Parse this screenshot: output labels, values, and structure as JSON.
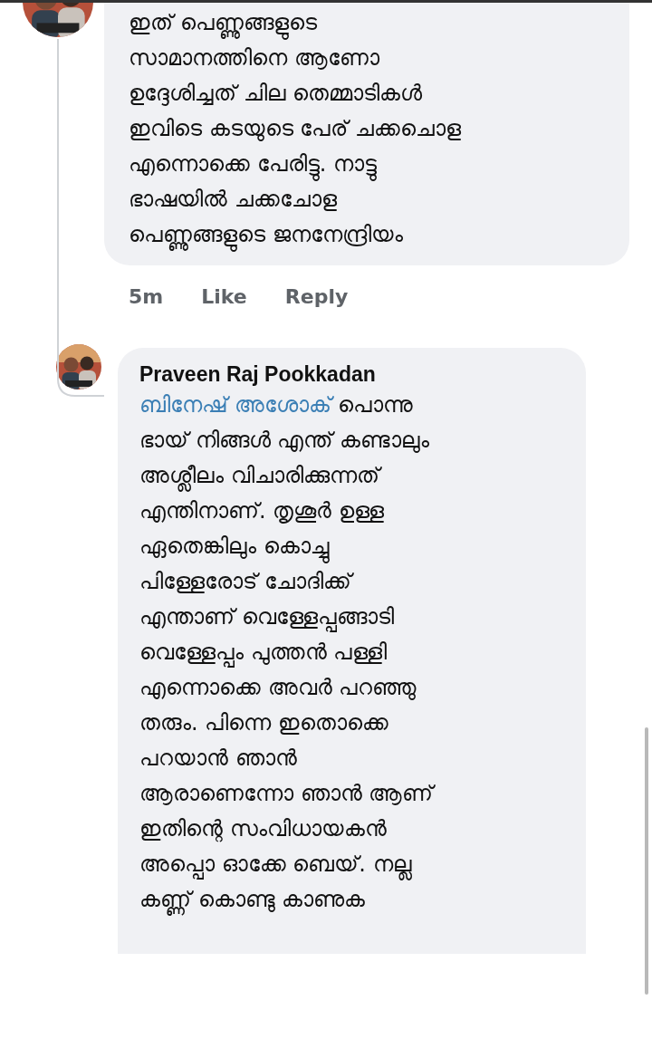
{
  "comments": [
    {
      "lines": [
        "ഇത് പെണ്ണുങ്ങളുടെ",
        "സാമാനത്തിനെ ആണോ",
        "ഉദ്ദേശിച്ചത് ചില തെമ്മാടികൾ",
        "ഇവിടെ കടയുടെ പേര് ചക്കചൊള",
        "എന്നൊക്കെ പേരിട്ടു. നാട്ടു",
        "ഭാഷയിൽ ചക്കചോള",
        "പെണ്ണുങ്ങളുടെ ജനനേന്ദ്രിയം"
      ],
      "time": "5m",
      "actions": [
        "Like",
        "Reply"
      ]
    },
    {
      "author": "Praveen Raj Pookkadan",
      "mention": "ബിനേഷ് അശോക്",
      "lines": [
        " പൊന്നു",
        "ഭായ് നിങ്ങൾ എന്ത് കണ്ടാലും",
        "അശ്ലീലം വിചാരിക്കുന്നത്",
        "എന്തിനാണ്. തൃശൂർ ഉള്ള",
        "ഏതെങ്കിലും കൊച്ചു",
        "പിള്ളേരോട് ചോദിക്ക്",
        "എന്താണ് വെള്ളേപ്പങ്ങാടി",
        "വെള്ളേപ്പം പുത്തൻ പള്ളി",
        "എന്നൊക്കെ അവർ പറഞ്ഞു",
        "തരും. പിന്നെ ഇതൊക്കെ",
        "പറയാൻ ഞാൻ",
        "ആരാണെന്നോ ഞാൻ ആണ്",
        "ഇതിന്റെ സംവിധായകൻ",
        "അപ്പൊ ഓക്കേ ബെയ്. നല്ല",
        "കണ്ണ് കൊണ്ടു കാണുക"
      ]
    }
  ]
}
